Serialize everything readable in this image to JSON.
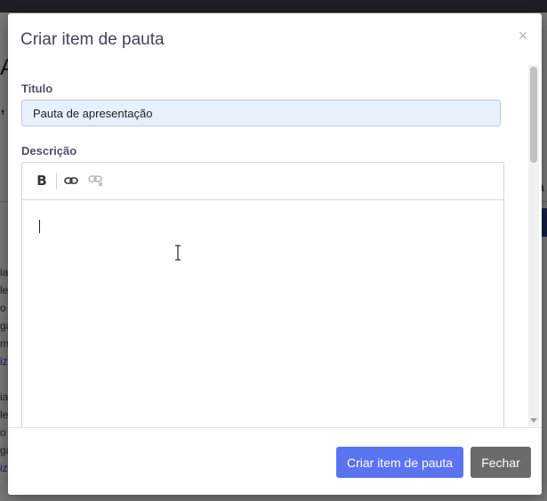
{
  "modal": {
    "title": "Criar item de pauta",
    "close_icon": "close-icon"
  },
  "form": {
    "title_label": "Titulo",
    "title_value": "Pauta de apresentação",
    "description_label": "Descrição"
  },
  "editor": {
    "toolbar": {
      "bold_label": "B",
      "link_icon": "link-icon",
      "unlink_icon": "unlink-icon"
    },
    "content": ""
  },
  "footer": {
    "primary_label": "Criar item de pauta",
    "secondary_label": "Fechar"
  },
  "colors": {
    "primary": "#5a73f0",
    "secondary": "#6b6b6b",
    "input_bg": "#e8f0fb"
  }
}
